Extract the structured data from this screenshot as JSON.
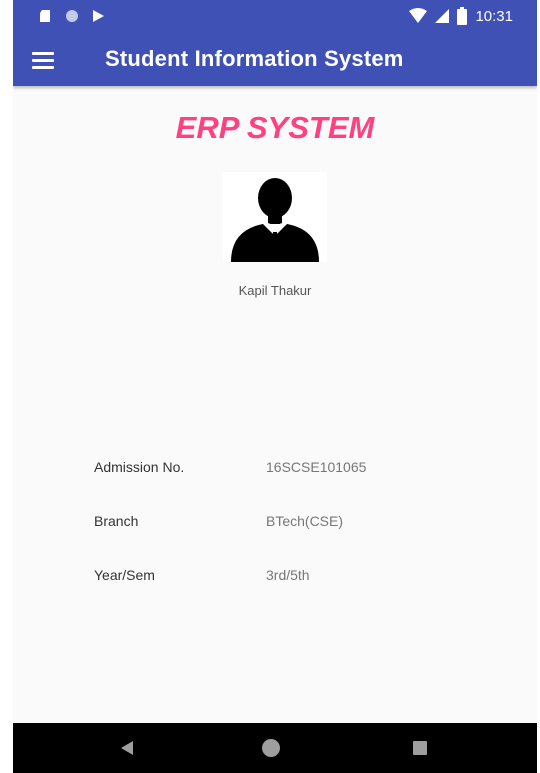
{
  "status_bar": {
    "time": "10:31",
    "left_icons": [
      "sd-card-icon",
      "circle-icon",
      "play-icon"
    ],
    "right_icons": [
      "wifi-icon",
      "signal-icon",
      "battery-icon"
    ]
  },
  "app_bar": {
    "title": "Student Information System",
    "menu_icon": "hamburger-menu-icon",
    "color": "#3f51b5"
  },
  "main": {
    "heading": "ERP SYSTEM",
    "heading_color": "#ff4081",
    "avatar_icon": "person-avatar-icon",
    "student_name": "Kapil Thakur",
    "details": [
      {
        "label": "Admission No.",
        "value": "16SCSE101065"
      },
      {
        "label": "Branch",
        "value": "BTech(CSE)"
      },
      {
        "label": "Year/Sem",
        "value": "3rd/5th"
      }
    ]
  },
  "nav_bar": {
    "buttons": [
      "back-icon",
      "home-icon",
      "recent-apps-icon"
    ]
  }
}
